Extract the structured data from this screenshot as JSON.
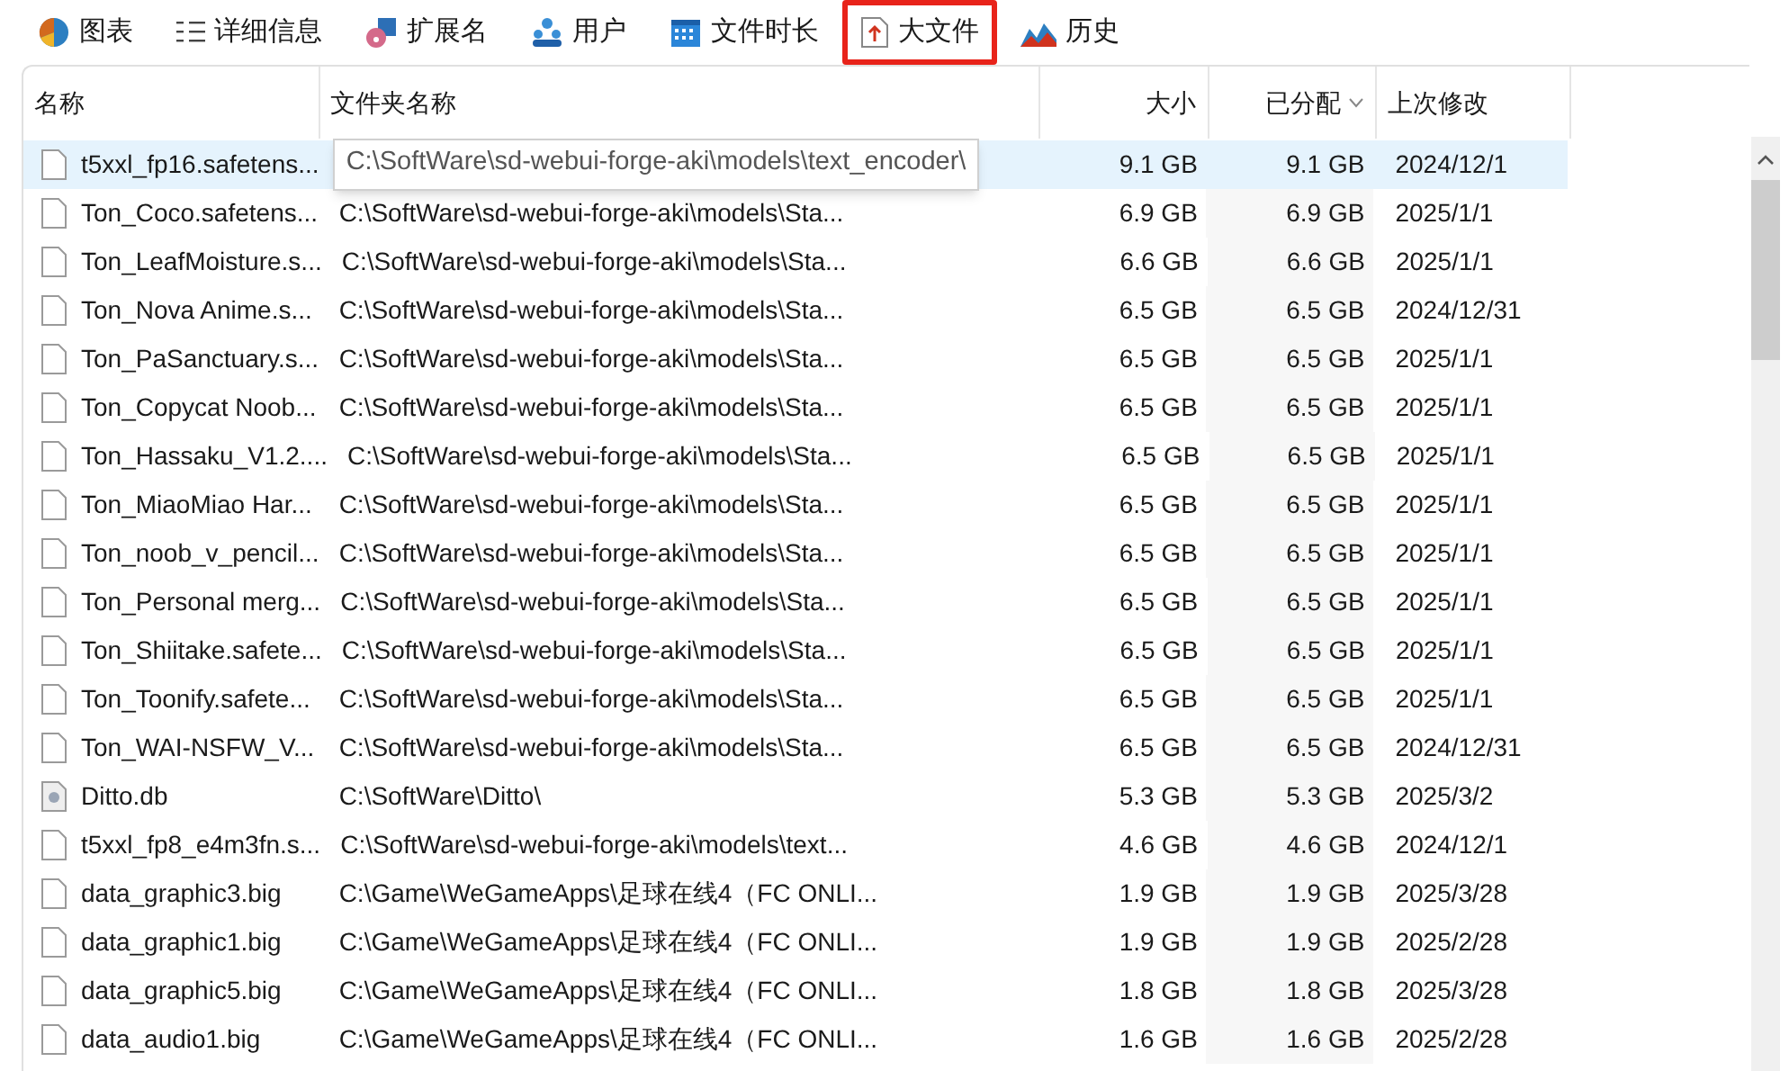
{
  "toolbar": [
    {
      "label": "图表",
      "selected": false
    },
    {
      "label": "详细信息",
      "selected": false
    },
    {
      "label": "扩展名",
      "selected": false
    },
    {
      "label": "用户",
      "selected": false
    },
    {
      "label": "文件时长",
      "selected": false
    },
    {
      "label": "大文件",
      "selected": true
    },
    {
      "label": "历史",
      "selected": false
    }
  ],
  "table": {
    "columns": [
      {
        "label": "名称",
        "sorted": false
      },
      {
        "label": "文件夹名称",
        "sorted": false
      },
      {
        "label": "大小",
        "sorted": false
      },
      {
        "label": "已分配",
        "sorted": true
      },
      {
        "label": "上次修改",
        "sorted": false
      }
    ],
    "rows": [
      {
        "kind": "file",
        "selected": true,
        "name": "t5xxl_fp16.safetens...",
        "size": "9.1 GB",
        "allocated": "9.1 GB",
        "modified": "2024/12/1",
        "tooltip": "C:\\SoftWare\\sd-webui-forge-aki\\models\\text_encoder\\"
      },
      {
        "kind": "file",
        "selected": false,
        "name": "Ton_Coco.safetens...",
        "folder": "C:\\SoftWare\\sd-webui-forge-aki\\models\\Sta...",
        "size": "6.9 GB",
        "allocated": "6.9 GB",
        "modified": "2025/1/1"
      },
      {
        "kind": "file",
        "selected": false,
        "name": "Ton_LeafMoisture.s...",
        "folder": "C:\\SoftWare\\sd-webui-forge-aki\\models\\Sta...",
        "size": "6.6 GB",
        "allocated": "6.6 GB",
        "modified": "2025/1/1"
      },
      {
        "kind": "file",
        "selected": false,
        "name": "Ton_Nova Anime.s...",
        "folder": "C:\\SoftWare\\sd-webui-forge-aki\\models\\Sta...",
        "size": "6.5 GB",
        "allocated": "6.5 GB",
        "modified": "2024/12/31"
      },
      {
        "kind": "file",
        "selected": false,
        "name": "Ton_PaSanctuary.s...",
        "folder": "C:\\SoftWare\\sd-webui-forge-aki\\models\\Sta...",
        "size": "6.5 GB",
        "allocated": "6.5 GB",
        "modified": "2025/1/1"
      },
      {
        "kind": "file",
        "selected": false,
        "name": "Ton_Copycat Noob...",
        "folder": "C:\\SoftWare\\sd-webui-forge-aki\\models\\Sta...",
        "size": "6.5 GB",
        "allocated": "6.5 GB",
        "modified": "2025/1/1"
      },
      {
        "kind": "file",
        "selected": false,
        "name": "Ton_Hassaku_V1.2....",
        "folder": "C:\\SoftWare\\sd-webui-forge-aki\\models\\Sta...",
        "size": "6.5 GB",
        "allocated": "6.5 GB",
        "modified": "2025/1/1"
      },
      {
        "kind": "file",
        "selected": false,
        "name": "Ton_MiaoMiao Har...",
        "folder": "C:\\SoftWare\\sd-webui-forge-aki\\models\\Sta...",
        "size": "6.5 GB",
        "allocated": "6.5 GB",
        "modified": "2025/1/1"
      },
      {
        "kind": "file",
        "selected": false,
        "name": "Ton_noob_v_pencil...",
        "folder": "C:\\SoftWare\\sd-webui-forge-aki\\models\\Sta...",
        "size": "6.5 GB",
        "allocated": "6.5 GB",
        "modified": "2025/1/1"
      },
      {
        "kind": "file",
        "selected": false,
        "name": "Ton_Personal merg...",
        "folder": "C:\\SoftWare\\sd-webui-forge-aki\\models\\Sta...",
        "size": "6.5 GB",
        "allocated": "6.5 GB",
        "modified": "2025/1/1"
      },
      {
        "kind": "file",
        "selected": false,
        "name": "Ton_Shiitake.safete...",
        "folder": "C:\\SoftWare\\sd-webui-forge-aki\\models\\Sta...",
        "size": "6.5 GB",
        "allocated": "6.5 GB",
        "modified": "2025/1/1"
      },
      {
        "kind": "file",
        "selected": false,
        "name": "Ton_Toonify.safete...",
        "folder": "C:\\SoftWare\\sd-webui-forge-aki\\models\\Sta...",
        "size": "6.5 GB",
        "allocated": "6.5 GB",
        "modified": "2025/1/1"
      },
      {
        "kind": "file",
        "selected": false,
        "name": "Ton_WAI-NSFW_V...",
        "folder": "C:\\SoftWare\\sd-webui-forge-aki\\models\\Sta...",
        "size": "6.5 GB",
        "allocated": "6.5 GB",
        "modified": "2024/12/31"
      },
      {
        "kind": "system",
        "selected": false,
        "name": "Ditto.db",
        "folder": "C:\\SoftWare\\Ditto\\",
        "size": "5.3 GB",
        "allocated": "5.3 GB",
        "modified": "2025/3/2"
      },
      {
        "kind": "file",
        "selected": false,
        "name": "t5xxl_fp8_e4m3fn.s...",
        "folder": "C:\\SoftWare\\sd-webui-forge-aki\\models\\text...",
        "size": "4.6 GB",
        "allocated": "4.6 GB",
        "modified": "2024/12/1"
      },
      {
        "kind": "file",
        "selected": false,
        "name": "data_graphic3.big",
        "folder": "C:\\Game\\WeGameApps\\足球在线4（FC ONLI...",
        "size": "1.9 GB",
        "allocated": "1.9 GB",
        "modified": "2025/3/28"
      },
      {
        "kind": "file",
        "selected": false,
        "name": "data_graphic1.big",
        "folder": "C:\\Game\\WeGameApps\\足球在线4（FC ONLI...",
        "size": "1.9 GB",
        "allocated": "1.9 GB",
        "modified": "2025/2/28"
      },
      {
        "kind": "file",
        "selected": false,
        "name": "data_graphic5.big",
        "folder": "C:\\Game\\WeGameApps\\足球在线4（FC ONLI...",
        "size": "1.8 GB",
        "allocated": "1.8 GB",
        "modified": "2025/3/28"
      },
      {
        "kind": "file",
        "selected": false,
        "name": "data_audio1.big",
        "folder": "C:\\Game\\WeGameApps\\足球在线4（FC ONLI...",
        "size": "1.6 GB",
        "allocated": "1.6 GB",
        "modified": "2025/2/28"
      }
    ]
  }
}
